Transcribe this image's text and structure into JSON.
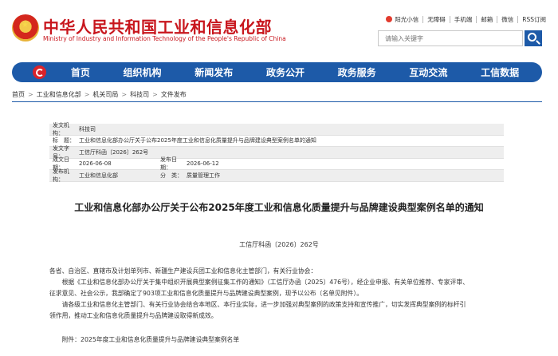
{
  "header": {
    "title_cn": "中华人民共和国工业和信息化部",
    "title_en": "Ministry of Industry and Information Technology of the People's Republic of China",
    "top_links": [
      {
        "label": "阳光小信",
        "icon": "sun-icon"
      },
      {
        "label": "无障碍"
      },
      {
        "label": "手机端"
      },
      {
        "label": "邮箱"
      },
      {
        "label": "微信"
      },
      {
        "label": "RSS订阅"
      }
    ],
    "search_placeholder": "请输入关键字",
    "brand_color": "#c8161d",
    "nav_color": "#1d5aa8"
  },
  "nav": {
    "items": [
      "首页",
      "组织机构",
      "新闻发布",
      "政务公开",
      "政务服务",
      "互动交流",
      "工信数据"
    ]
  },
  "breadcrumb": [
    "首页",
    "工业和信息化部",
    "机关司局",
    "科技司",
    "文件发布"
  ],
  "meta": {
    "issuer_label": "发文机构：",
    "issuer": "科技司",
    "title_label": "标　题：",
    "title": "工业和信息化部办公厅关于公布2025年度工业和信息化质量提升与品牌建设典型案例名单的通知",
    "docno_label": "发文字号：",
    "docno": "工信厅科函〔2026〕262号",
    "created_label": "成文日期：",
    "created": "2026-06-08",
    "published_label": "发布日期：",
    "published": "2026-06-12",
    "org_label": "发布机构：",
    "org": "工业和信息化部",
    "category_label": "分　类：",
    "category": "质量管理工作"
  },
  "article": {
    "title": "工业和信息化部办公厅关于公布2025年度工业和信息化质量提升与品牌建设典型案例名单的通知",
    "doc_number": "工信厅科函〔2026〕262号",
    "salutation": "各省、自治区、直辖市及计划单列市、新疆生产建设兵团工业和信息化主管部门，有关行业协会：",
    "p1_line1": "　　根据《工业和信息化部办公厅关于集中组织开展典型案例征集工作的通知》（工信厅办函〔2025〕476号），经企业申报、有关单位推荐、专家评审、",
    "p1_line2": "征求意见、社会公示，我部确定了903项工业和信息化质量提升与品牌建设典型案例，现予以公布（名单见附件）。",
    "p2_line1": "　　请各级工业和信息化主管部门、有关行业协会结合本地区、本行业实际，进一步加强对典型案例的政策支持和宣传推广，切实发挥典型案例的标杆引",
    "p2_line2": "领作用，推动工业和信息化质量提升与品牌建设取得新成效。",
    "attachment": "　　附件：2025年度工业和信息化质量提升与品牌建设典型案例名单"
  }
}
